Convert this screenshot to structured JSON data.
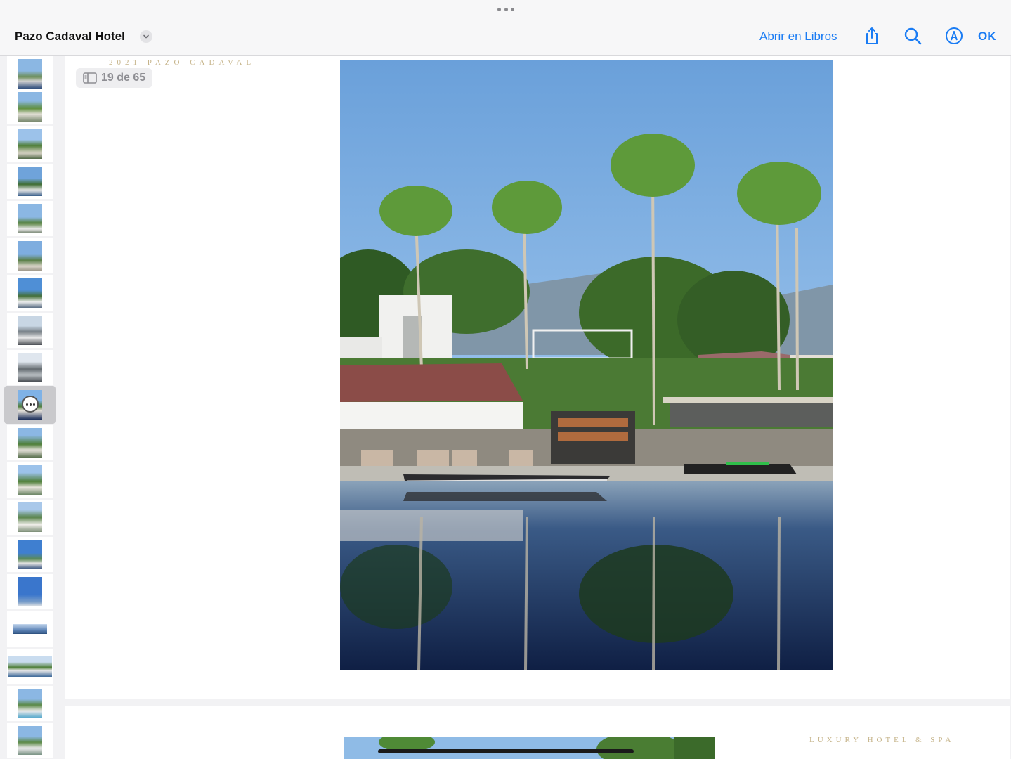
{
  "toolbar": {
    "title": "Pazo Cadaval Hotel",
    "open_in_books": "Abrir en Libros",
    "ok": "OK",
    "icons": [
      "share-icon",
      "search-icon",
      "markup-icon",
      "chevron-down-icon",
      "more-dots-icon"
    ]
  },
  "document": {
    "page_counter": "19 de 65",
    "page_header": "2021 PAZO CADAVAL",
    "next_page_header": "LUXURY HOTEL & SPA"
  },
  "sidebar": {
    "thumbnail_count": 19,
    "current_index": 9
  },
  "colors": {
    "accent": "#1a7cf4",
    "gold": "#c6b48a",
    "sky": "#7fb2e6",
    "water": "#1b2e5a"
  }
}
